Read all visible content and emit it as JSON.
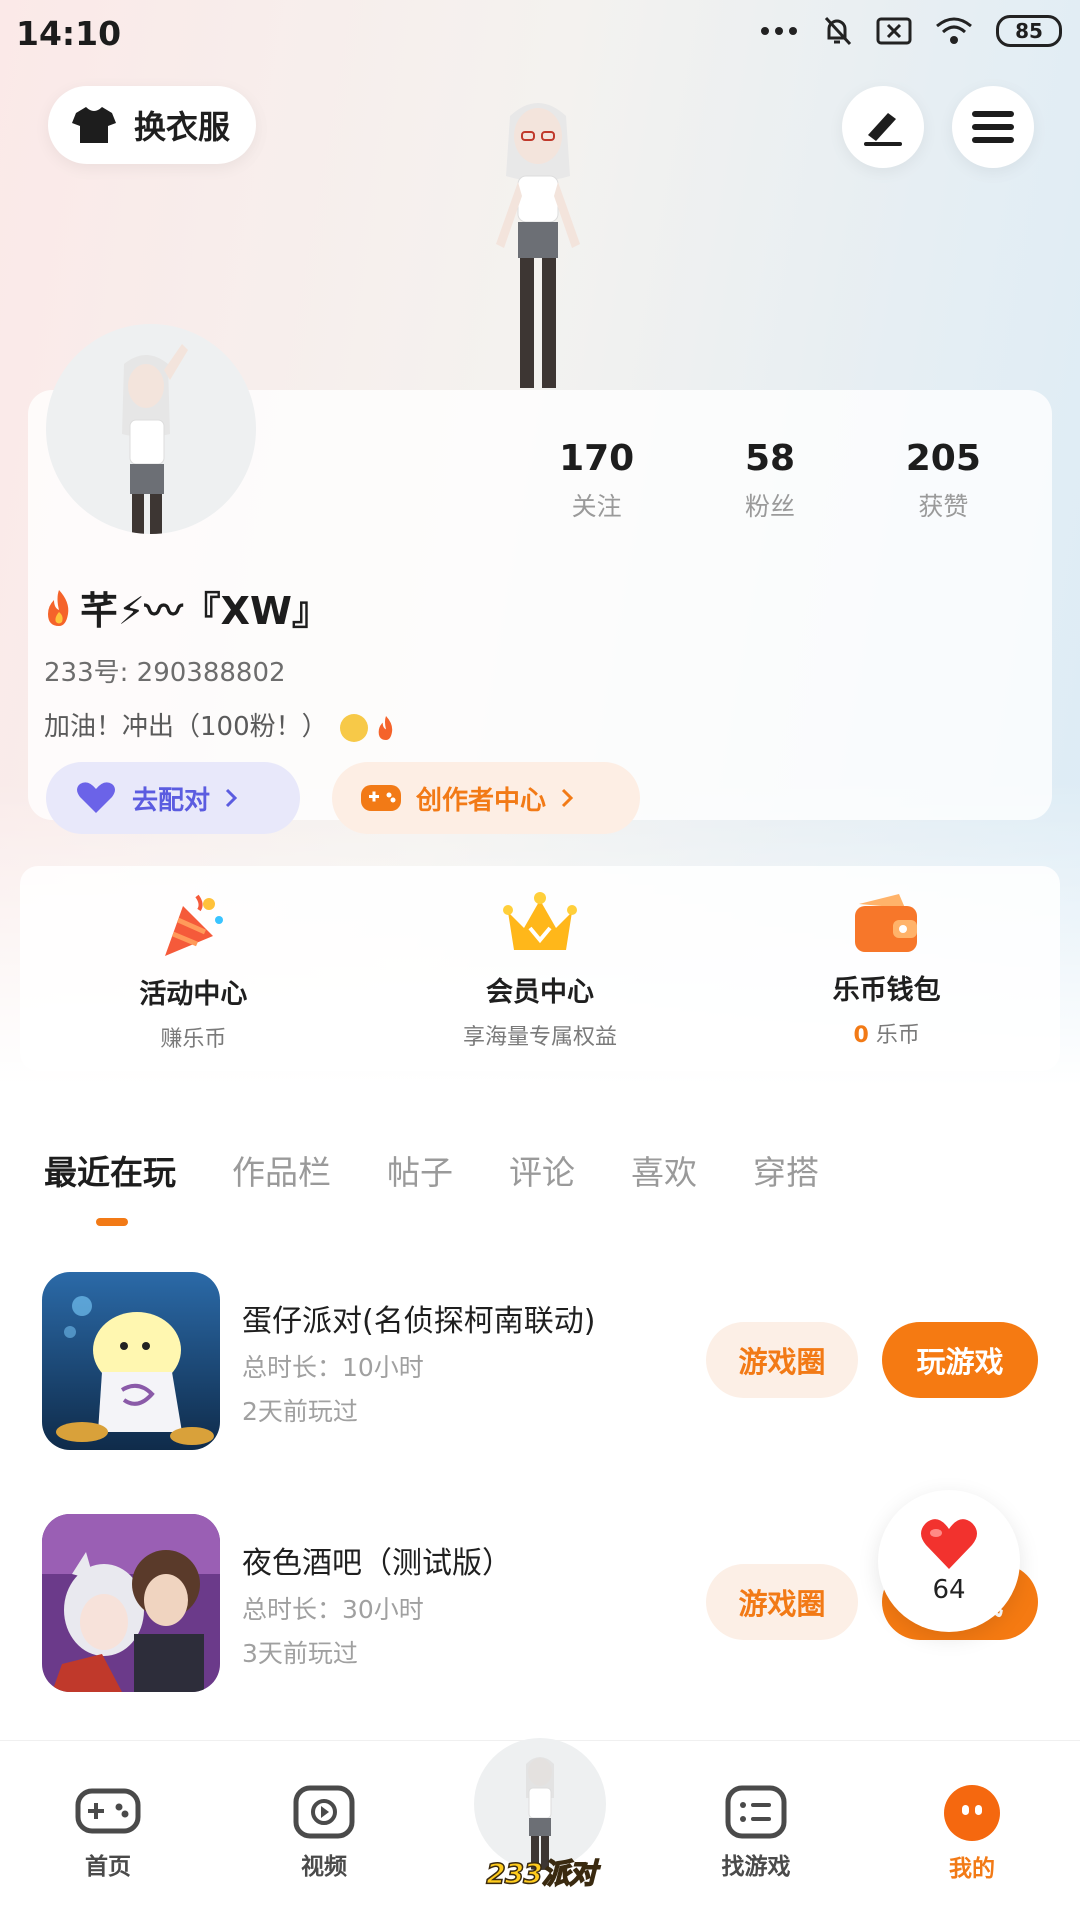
{
  "status_bar": {
    "time": "14:10",
    "battery": "85"
  },
  "top": {
    "outfit_label": "换衣服"
  },
  "profile": {
    "username": "芊⚡〰『XW』",
    "uid_text": "233号: 290388802",
    "bio": "加油！冲出（100粉！）"
  },
  "stats": [
    {
      "value": "170",
      "label": "关注"
    },
    {
      "value": "58",
      "label": "粉丝"
    },
    {
      "value": "205",
      "label": "获赞"
    }
  ],
  "actions": {
    "match_label": "去配对",
    "creator_label": "创作者中心"
  },
  "features": [
    {
      "title": "活动中心",
      "subtitle": "赚乐币"
    },
    {
      "title": "会员中心",
      "subtitle": "享海量专属权益"
    },
    {
      "title": "乐币钱包",
      "subtitle_value": "0",
      "subtitle_unit": "乐币"
    }
  ],
  "tabs": [
    "最近在玩",
    "作品栏",
    "帖子",
    "评论",
    "喜欢",
    "穿搭"
  ],
  "games": [
    {
      "name": "蛋仔派对(名侦探柯南联动)",
      "duration": "总时长：10小时",
      "last_played": "2天前玩过",
      "circle_label": "游戏圈",
      "play_label": "玩游戏"
    },
    {
      "name": "夜色酒吧（测试版）",
      "duration": "总时长：30小时",
      "last_played": "3天前玩过",
      "circle_label": "游戏圈",
      "play_label": "玩游戏"
    }
  ],
  "like_float": {
    "count": "64"
  },
  "nav": {
    "items": [
      "首页",
      "视频",
      "找游戏",
      "我的"
    ],
    "center_label": "233派对"
  },
  "colors": {
    "accent": "#f27a16",
    "match": "#5b5ce0"
  }
}
